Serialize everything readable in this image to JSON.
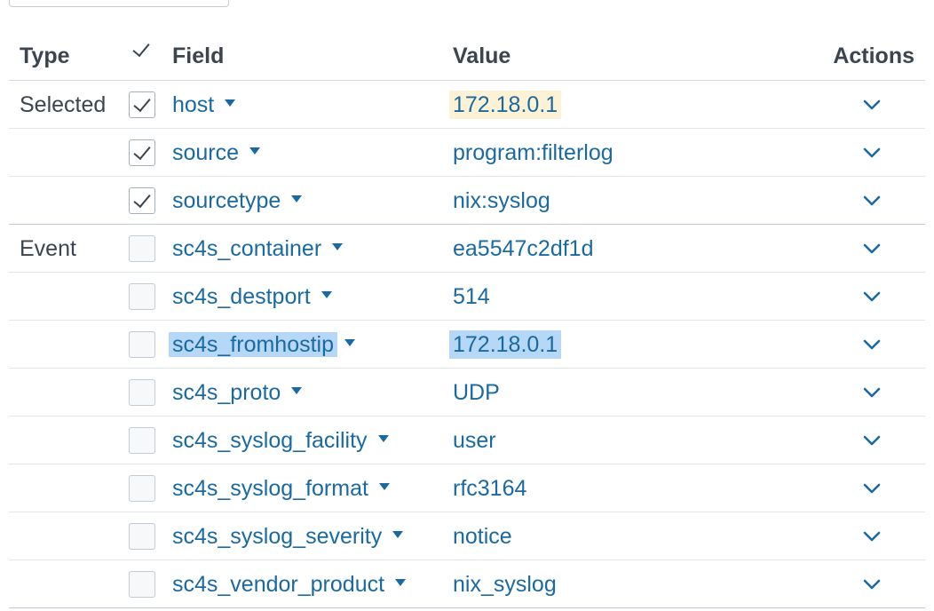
{
  "header": {
    "type": "Type",
    "field": "Field",
    "value": "Value",
    "actions": "Actions"
  },
  "rows": [
    {
      "type": "Selected",
      "field": "host",
      "value": "172.18.0.1",
      "checked": true,
      "highlight_field": false,
      "value_highlight": "yellow"
    },
    {
      "type": "",
      "field": "source",
      "value": "program:filterlog",
      "checked": true,
      "highlight_field": false,
      "value_highlight": ""
    },
    {
      "type": "",
      "field": "sourcetype",
      "value": "nix:syslog",
      "checked": true,
      "highlight_field": false,
      "value_highlight": ""
    },
    {
      "type": "Event",
      "field": "sc4s_container",
      "value": "ea5547c2df1d",
      "checked": false,
      "highlight_field": false,
      "value_highlight": ""
    },
    {
      "type": "",
      "field": "sc4s_destport",
      "value": "514",
      "checked": false,
      "highlight_field": false,
      "value_highlight": ""
    },
    {
      "type": "",
      "field": "sc4s_fromhostip",
      "value": "172.18.0.1",
      "checked": false,
      "highlight_field": true,
      "value_highlight": "blue"
    },
    {
      "type": "",
      "field": "sc4s_proto",
      "value": "UDP",
      "checked": false,
      "highlight_field": false,
      "value_highlight": ""
    },
    {
      "type": "",
      "field": "sc4s_syslog_facility",
      "value": "user",
      "checked": false,
      "highlight_field": false,
      "value_highlight": ""
    },
    {
      "type": "",
      "field": "sc4s_syslog_format",
      "value": "rfc3164",
      "checked": false,
      "highlight_field": false,
      "value_highlight": ""
    },
    {
      "type": "",
      "field": "sc4s_syslog_severity",
      "value": "notice",
      "checked": false,
      "highlight_field": false,
      "value_highlight": ""
    },
    {
      "type": "",
      "field": "sc4s_vendor_product",
      "value": "nix_syslog",
      "checked": false,
      "highlight_field": false,
      "value_highlight": ""
    }
  ],
  "icons": {
    "caret": "caret-down-icon",
    "action": "chevron-down-icon",
    "check": "checkmark-icon"
  },
  "colors": {
    "link": "#1a6aa1",
    "text": "#3c444d",
    "highlight_blue": "#b6d7f6",
    "highlight_yellow": "#fdf2d6"
  }
}
